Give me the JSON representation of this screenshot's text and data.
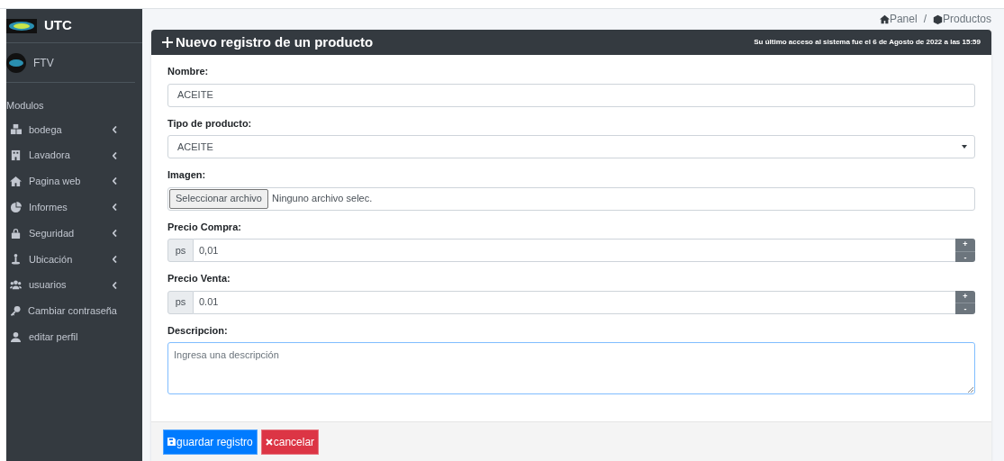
{
  "sidebar": {
    "brand": "UTC",
    "user": "FTV",
    "section_label": "Modulos",
    "items": [
      {
        "label": "bodega",
        "expandable": true
      },
      {
        "label": "Lavadora",
        "expandable": true
      },
      {
        "label": "Pagina web",
        "expandable": true
      },
      {
        "label": "Informes",
        "expandable": true
      },
      {
        "label": "Seguridad",
        "expandable": true
      },
      {
        "label": "Ubicación",
        "expandable": true
      },
      {
        "label": "usuarios",
        "expandable": true
      },
      {
        "label": "Cambiar contraseña",
        "expandable": false
      },
      {
        "label": "editar perfil",
        "expandable": false
      }
    ]
  },
  "breadcrumb": [
    {
      "label": "Panel"
    },
    {
      "label": "Productos"
    }
  ],
  "breadcrumb_separator": "/",
  "card": {
    "title": "Nuevo registro de un producto",
    "last_access": "Su último acceso al sistema fue el 6 de Agosto de 2022 a las 15:59",
    "fields": [
      {
        "kind": "text",
        "label": "Nombre:",
        "value": "ACEITE"
      },
      {
        "kind": "select",
        "label": "Tipo de producto:",
        "value": "ACEITE"
      },
      {
        "kind": "file",
        "label": "Imagen:",
        "button": "Seleccionar archivo",
        "value": "Ninguno archivo selec."
      },
      {
        "kind": "number",
        "label": "Precio Compra:",
        "prefix": "ps",
        "value": "0,01",
        "up": "+",
        "down": "-"
      },
      {
        "kind": "number",
        "label": "Precio Venta:",
        "prefix": "ps",
        "value": "0.01",
        "up": "+",
        "down": "-"
      },
      {
        "kind": "textarea",
        "label": "Descripcion:",
        "placeholder": "Ingresa una descripción"
      }
    ],
    "buttons": [
      {
        "kind": "save",
        "label": "guardar registro"
      },
      {
        "kind": "cancel",
        "label": "cancelar"
      }
    ]
  }
}
